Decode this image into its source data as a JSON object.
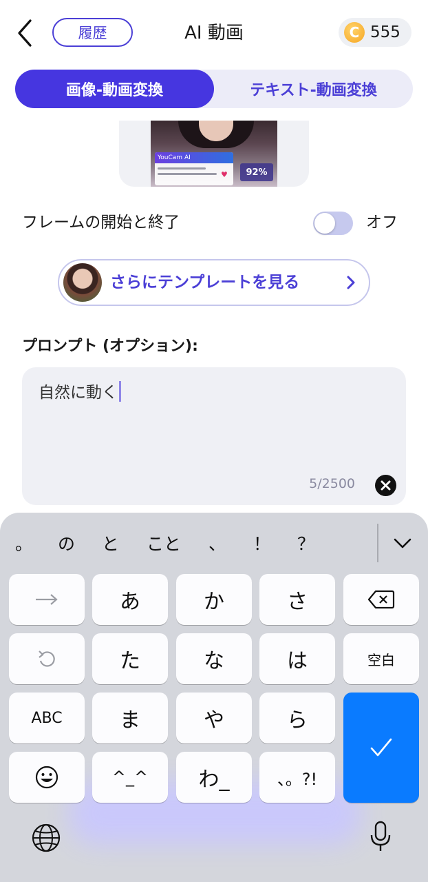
{
  "header": {
    "history_label": "履歴",
    "title": "AI 動画",
    "coin_symbol": "C",
    "coin_count": "555"
  },
  "mode_tabs": [
    {
      "label": "画像-動画変換",
      "active": true
    },
    {
      "label": "テキスト-動画変換",
      "active": false
    }
  ],
  "preview": {
    "overlay_title": "YouCam AI",
    "percent": "92%"
  },
  "frame_toggle": {
    "label": "フレームの開始と終了",
    "state_label": "オフ",
    "on": false
  },
  "template_button": {
    "label": "さらにテンプレートを見る"
  },
  "prompt": {
    "label": "プロンプト (オプション):",
    "value": "自然に動く",
    "char_count": "5/2500"
  },
  "keyboard": {
    "suggestions": [
      "。",
      "の",
      "と",
      "こと",
      "、",
      "！",
      "？"
    ],
    "keys": {
      "a": "あ",
      "ka": "か",
      "sa": "さ",
      "ta": "た",
      "na": "な",
      "ha": "は",
      "space": "空白",
      "abc": "ABC",
      "ma": "ま",
      "ya": "や",
      "ra": "ら",
      "kaomoji": "^_^",
      "wa": "わ_",
      "punct": "、。?!"
    }
  },
  "colors": {
    "accent": "#4636e0",
    "accent_text": "#4b3fd6",
    "enter_key": "#0a7bff",
    "keyboard_bg": "#d4d6dc"
  }
}
